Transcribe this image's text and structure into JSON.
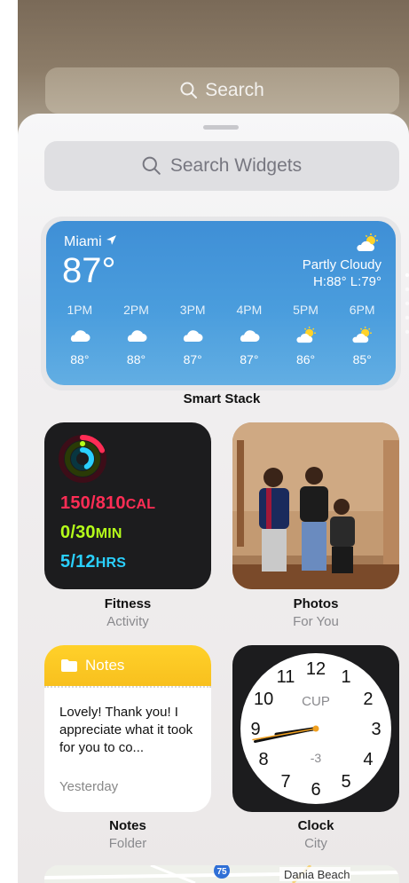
{
  "home": {
    "search_label": "Search"
  },
  "gallery": {
    "search_placeholder": "Search Widgets"
  },
  "weather": {
    "city": "Miami",
    "temp": "87°",
    "condition": "Partly Cloudy",
    "high_low": "H:88° L:79°",
    "hours": [
      {
        "time": "1PM",
        "icon": "cloud",
        "temp": "88°"
      },
      {
        "time": "2PM",
        "icon": "cloud",
        "temp": "88°"
      },
      {
        "time": "3PM",
        "icon": "cloud",
        "temp": "87°"
      },
      {
        "time": "4PM",
        "icon": "cloud",
        "temp": "87°"
      },
      {
        "time": "5PM",
        "icon": "partly-cloudy-sun",
        "temp": "86°"
      },
      {
        "time": "6PM",
        "icon": "partly-cloudy-sun",
        "temp": "85°"
      }
    ],
    "stack_label": "Smart Stack"
  },
  "fitness": {
    "move_value": "150/810",
    "move_unit": "CAL",
    "exercise_value": "0/30",
    "exercise_unit": "MIN",
    "stand_value": "5/12",
    "stand_unit": "HRS",
    "move_progress": 0.185,
    "exercise_progress": 0.0,
    "stand_progress": 0.417,
    "title": "Fitness",
    "subtitle": "Activity"
  },
  "photos": {
    "title": "Photos",
    "subtitle": "For You"
  },
  "notes": {
    "header": "Notes",
    "body": "Lovely!  Thank you! I appreciate what it took for you to co...",
    "date": "Yesterday",
    "title": "Notes",
    "subtitle": "Folder"
  },
  "clock": {
    "numbers": [
      "12",
      "1",
      "2",
      "3",
      "4",
      "5",
      "6",
      "7",
      "8",
      "9",
      "10",
      "11"
    ],
    "city_code": "CUP",
    "offset": "-3",
    "time_shown": "8:43",
    "title": "Clock",
    "subtitle": "City"
  },
  "maps": {
    "route_badge": "75",
    "place": "Dania Beach"
  },
  "colors": {
    "move": "#ff2d55",
    "exercise": "#b5ff1a",
    "stand": "#2ad0ff",
    "notes_yellow": "#f9c320",
    "weather_blue": "#4a9ddd",
    "clock_hand": "#f0a020"
  }
}
